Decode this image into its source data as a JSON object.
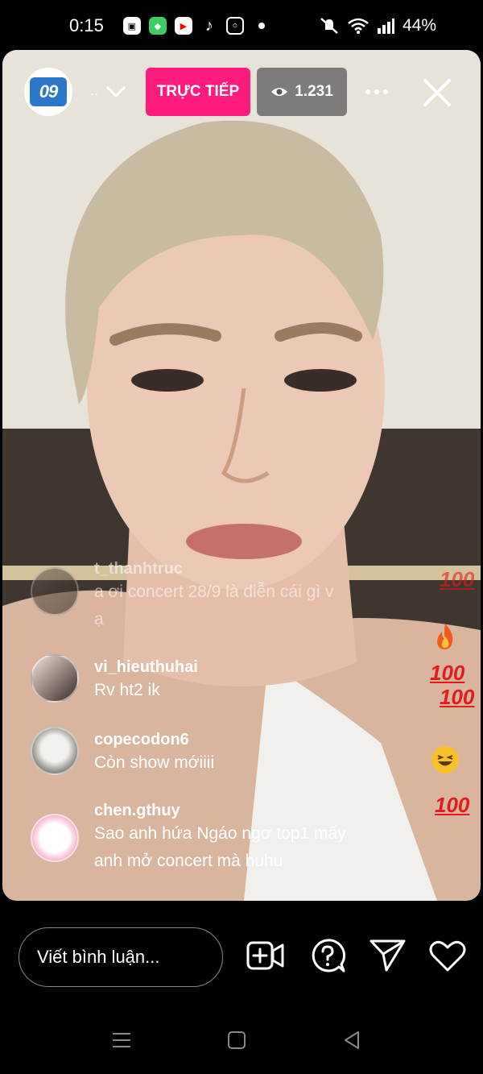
{
  "status_bar": {
    "time": "0:15",
    "battery": "44%",
    "icons": [
      "lock-app-icon",
      "app-icon",
      "youtube-icon",
      "tiktok-icon",
      "instagram-icon",
      "notification-dot-icon",
      "mute-icon",
      "wifi-icon",
      "signal-icon",
      "battery-icon"
    ]
  },
  "live": {
    "host_avatar_text": "09",
    "host_name": "..",
    "live_label": "TRỰC TIẾP",
    "viewer_count": "1.231"
  },
  "comments": [
    {
      "user": "t_thanhtruc",
      "text_line1": "a ơi concert 28/9 là diễn cái gì v",
      "text_line2": "ạ"
    },
    {
      "user": "vi_hieuthuhai",
      "text_line1": "Rv ht2 ik",
      "text_line2": ""
    },
    {
      "user": "copecodon6",
      "text_line1": "Còn show mớiiii",
      "text_line2": ""
    },
    {
      "user": "chen.gthuy",
      "text_line1": "Sao anh hứa Ngáo ngơ top1 mấy",
      "text_line2": "anh mở concert mà huhu"
    }
  ],
  "reactions": [
    "100",
    "fire",
    "100",
    "100",
    "laughing",
    "100"
  ],
  "bottom_bar": {
    "comment_placeholder": "Viết bình luận..."
  },
  "colors": {
    "live_badge": "#ff1a7d",
    "viewer_badge": "#5a5a5a",
    "background": "#000000",
    "reaction_red": "#e21b1b"
  }
}
